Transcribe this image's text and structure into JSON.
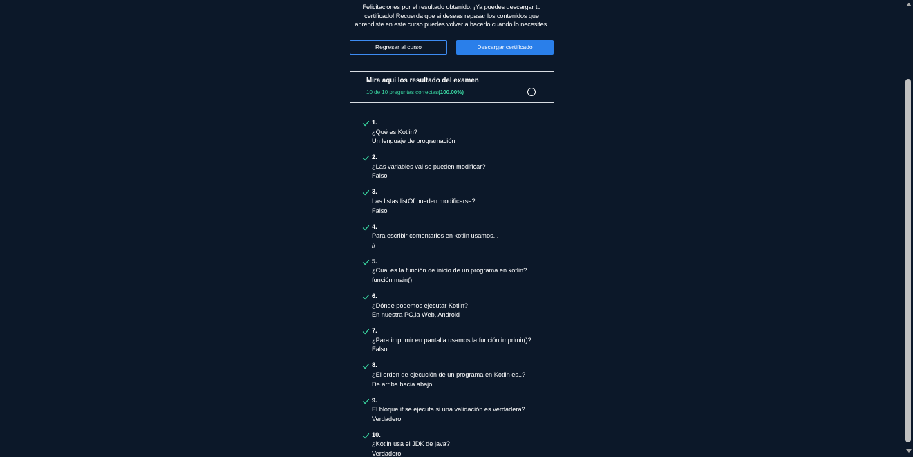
{
  "congrats_text": "Felicitaciones por el resultado obtenido, ¡Ya puedes descargar tu certificado! Recuerda que si deseas repasar los contenidos que aprendiste en este curso puedes volver a hacerlo cuando lo necesites.",
  "buttons": {
    "back_label": "Regresar al curso",
    "download_label": "Descargar certificado"
  },
  "results": {
    "title": "Mira aquí los resultado del examen",
    "score_prefix": "10 de 10 preguntas correctas",
    "score_percent": "(100.00%)"
  },
  "colors": {
    "background": "#0c1829",
    "accent_blue": "#2a7fea",
    "success_green": "#39d6a1"
  },
  "questions": [
    {
      "num": "1.",
      "question": "¿Qué es Kotlin?",
      "answer": "Un lenguaje de programación",
      "status_icon": "check-icon"
    },
    {
      "num": "2.",
      "question": "¿Las variables val se pueden modificar?",
      "answer": "Falso",
      "status_icon": "check-icon"
    },
    {
      "num": "3.",
      "question": "Las listas listOf pueden modificarse?",
      "answer": "Falso",
      "status_icon": "check-icon"
    },
    {
      "num": "4.",
      "question": "Para escribir comentarios en kotlin usamos...",
      "answer": "//",
      "status_icon": "check-icon"
    },
    {
      "num": "5.",
      "question": "¿Cual es la función de inicio de un programa en kotlin?",
      "answer": "función main()",
      "status_icon": "check-icon"
    },
    {
      "num": "6.",
      "question": "¿Dónde podemos ejecutar Kotlin?",
      "answer": "En nuestra PC,la Web, Android",
      "status_icon": "check-icon"
    },
    {
      "num": "7.",
      "question": "¿Para imprimir en pantalla usamos la función imprimir()?",
      "answer": "Falso",
      "status_icon": "check-icon"
    },
    {
      "num": "8.",
      "question": "¿El orden de ejecución de un programa en Kotlin es..?",
      "answer": "De arriba hacia abajo",
      "status_icon": "check-icon"
    },
    {
      "num": "9.",
      "question": "El bloque if se ejecuta si una validación es verdadera?",
      "answer": "Verdadero",
      "status_icon": "check-icon"
    },
    {
      "num": "10.",
      "question": "¿Kotlin usa el JDK de java?",
      "answer": "Verdadero",
      "status_icon": "check-icon"
    }
  ]
}
